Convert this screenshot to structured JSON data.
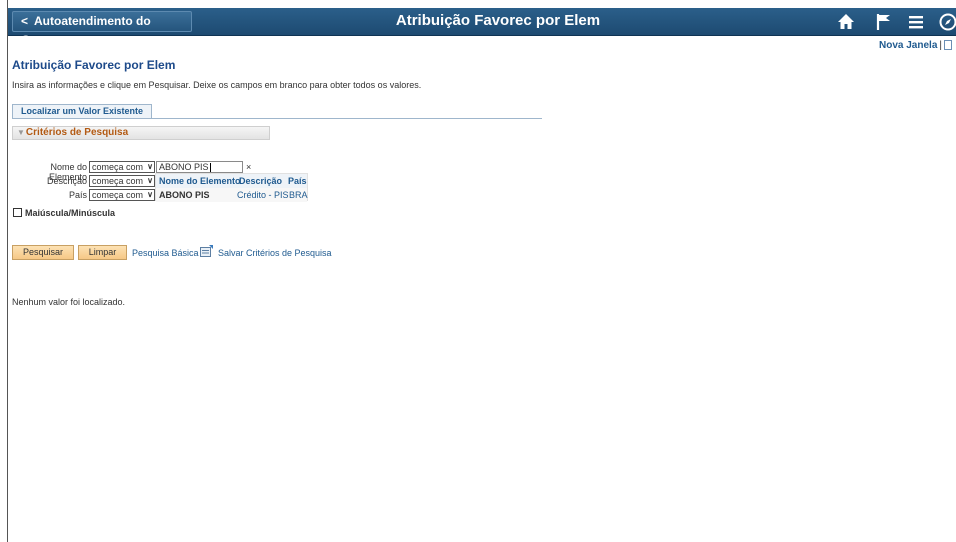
{
  "header": {
    "back_label": "Autoatendimento do Gerente",
    "app_title": "Atribuição Favorec por Elem",
    "icons": [
      "home-icon",
      "flag-icon",
      "menu-icon",
      "navbar-icon"
    ]
  },
  "top_links": {
    "new_window": "Nova Janela",
    "separator": "|"
  },
  "page": {
    "title": "Atribuição Favorec por Elem",
    "instructions": "Insira as informações e clique em Pesquisar. Deixe os campos em branco para obter todos os valores."
  },
  "tabs": [
    {
      "label": "Localizar um Valor Existente"
    }
  ],
  "search_criteria": {
    "section_title": "Critérios de Pesquisa",
    "fields": [
      {
        "label": "Nome do Elemento",
        "operator": "começa com",
        "value": "ABONO PIS"
      },
      {
        "label": "Descrição",
        "operator": "começa com",
        "value": ""
      },
      {
        "label": "País",
        "operator": "começa com",
        "value": ""
      }
    ],
    "clear_symbol": "×"
  },
  "suggestions": {
    "headers": [
      "Nome do Elemento",
      "Descrição",
      "País"
    ],
    "rows": [
      {
        "name": "ABONO PIS",
        "description": "Crédito - PIS",
        "country": "BRA"
      }
    ]
  },
  "case_sensitive": {
    "label": "Maiúscula/Minúscula",
    "checked": false
  },
  "actions": {
    "search": "Pesquisar",
    "clear": "Limpar",
    "basic_search": "Pesquisa Básica",
    "save_criteria": "Salvar Critérios de Pesquisa"
  },
  "results": {
    "message": "Nenhum valor foi localizado."
  },
  "colors": {
    "header_bg": "#1d4a71",
    "link": "#1f5a8f",
    "section_title": "#b35a13",
    "button": "#f6c886"
  }
}
